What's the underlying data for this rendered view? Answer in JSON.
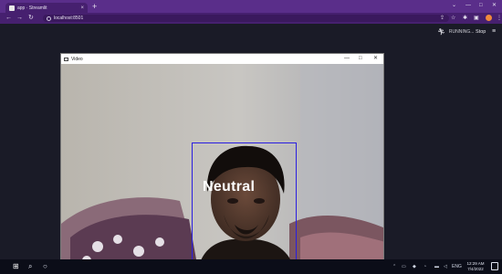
{
  "browser": {
    "tab_title": "app · Streamlit",
    "tab_close": "×",
    "new_tab": "+",
    "url": "localhost:8501",
    "nav": {
      "back": "←",
      "forward": "→",
      "reload": "↻"
    },
    "window_controls": {
      "minimize": "⌄",
      "restore": "—",
      "maximize": "□",
      "close": "✕"
    },
    "toolbar_icons": [
      "share-icon",
      "star-icon",
      "extensions-icon",
      "sidebar-icon",
      "profile-icon",
      "kebab-menu-icon"
    ],
    "profile_color": "#f08a3c"
  },
  "streamlit": {
    "status": "RUNNING...",
    "stop_label": "Stop",
    "menu": "≡"
  },
  "cv_window": {
    "title": "Video",
    "minimize": "—",
    "maximize": "□",
    "close": "✕",
    "emotion_label": "Neutral",
    "box_color": "#2a1ee0"
  },
  "taskbar": {
    "time": "12:29 AM",
    "date": "7/4/2022",
    "tray": "ENG"
  },
  "colors": {
    "chrome_tabstrip": "#5a2e8a",
    "chrome_toolbar": "#46206f",
    "app_background": "#1a1b27",
    "taskbar": "#0b0d18"
  }
}
